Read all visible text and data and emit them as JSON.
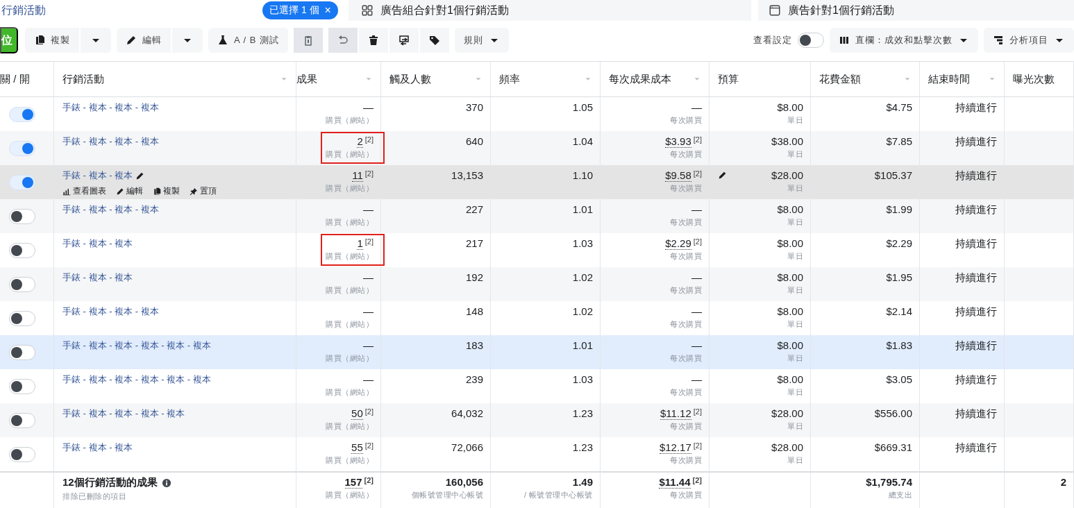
{
  "top_bar": {
    "breadcrumb": "行銷活動",
    "selection_chip": {
      "label": "已選擇 1 個",
      "close": "×"
    },
    "tabs": [
      {
        "kind": "ad_sets",
        "label": "廣告組合針對1個行銷活動"
      },
      {
        "kind": "ads",
        "label": "廣告針對1個行銷活動"
      }
    ]
  },
  "toolbar": {
    "create_button": "位",
    "items": [
      {
        "kind": "split",
        "label": "複製",
        "disabled": false
      },
      {
        "kind": "split",
        "label": "編輯",
        "disabled": false
      },
      {
        "kind": "button",
        "label": "A / B 測試",
        "disabled": false
      },
      {
        "kind": "icon",
        "disabled": true
      },
      {
        "kind": "icon",
        "disabled": true
      },
      {
        "kind": "icon",
        "disabled": false
      },
      {
        "kind": "icon",
        "disabled": false
      },
      {
        "kind": "icon",
        "disabled": false
      },
      {
        "kind": "dropdown",
        "label": "規則",
        "disabled": false
      }
    ],
    "view_settings": {
      "label": "查看設定",
      "on": false
    },
    "columns_button": "直欄：成效和點擊次數",
    "breakdown_button": "分析項目"
  },
  "table": {
    "columns": [
      {
        "label": "關 / 開",
        "sort_menu": false
      },
      {
        "label": "行銷活動",
        "sort_menu": true
      },
      {
        "label": "成果",
        "sort_menu": true
      },
      {
        "label": "觸及人數",
        "sort_menu": true
      },
      {
        "label": "頻率",
        "sort_menu": true
      },
      {
        "label": "每次成果成本",
        "sort_menu": true
      },
      {
        "label": "預算",
        "sort_menu": false
      },
      {
        "label": "花費金額",
        "sort_menu": true
      },
      {
        "label": "結束時間",
        "sort_menu": true
      },
      {
        "label": "曝光次數",
        "sort_menu": false
      }
    ],
    "rows": [
      {
        "on": true,
        "hovered": false,
        "highlighted": false,
        "annotated": false,
        "name": "手錶 - 複本 - 複本 - 複本",
        "result": "—",
        "result_note": "",
        "result_sub": "購買（網站）",
        "reach": "370",
        "frequency": "1.05",
        "cost": "—",
        "cost_note": "",
        "cost_sub": "每次購買",
        "budget": "$8.00",
        "budget_sub": "單日",
        "spent": "$4.75",
        "end": "持續進行"
      },
      {
        "on": true,
        "hovered": false,
        "highlighted": false,
        "annotated": true,
        "name": "手錶 - 複本 - 複本 - 複本",
        "result": "2",
        "result_note": "[2]",
        "result_sub": "購買（網站）",
        "reach": "640",
        "frequency": "1.04",
        "cost": "$3.93",
        "cost_note": "[2]",
        "cost_sub": "每次購買",
        "budget": "$38.00",
        "budget_sub": "單日",
        "spent": "$7.85",
        "end": "持續進行"
      },
      {
        "on": true,
        "hovered": true,
        "highlighted": false,
        "annotated": false,
        "name": "手錶 - 複本 - 複本",
        "result": "11",
        "result_note": "[2]",
        "result_sub": "購買（網站）",
        "reach": "13,153",
        "frequency": "1.10",
        "cost": "$9.58",
        "cost_note": "[2]",
        "cost_sub": "每次購買",
        "budget": "$28.00",
        "budget_sub": "單日",
        "spent": "$105.37",
        "end": "持續進行",
        "actions": [
          "查看圖表",
          "編輯",
          "複製",
          "置頂"
        ]
      },
      {
        "on": false,
        "hovered": false,
        "highlighted": false,
        "annotated": false,
        "name": "手錶 - 複本 - 複本 - 複本",
        "result": "—",
        "result_note": "",
        "result_sub": "購買（網站）",
        "reach": "227",
        "frequency": "1.01",
        "cost": "—",
        "cost_note": "",
        "cost_sub": "每次購買",
        "budget": "$8.00",
        "budget_sub": "單日",
        "spent": "$1.99",
        "end": "持續進行"
      },
      {
        "on": false,
        "hovered": false,
        "highlighted": false,
        "annotated": true,
        "name": "手錶 - 複本 - 複本",
        "result": "1",
        "result_note": "[2]",
        "result_sub": "購買（網站）",
        "reach": "217",
        "frequency": "1.03",
        "cost": "$2.29",
        "cost_note": "[2]",
        "cost_sub": "每次購買",
        "budget": "$8.00",
        "budget_sub": "單日",
        "spent": "$2.29",
        "end": "持續進行"
      },
      {
        "on": false,
        "hovered": false,
        "highlighted": false,
        "annotated": false,
        "name": "手錶 - 複本 - 複本",
        "result": "—",
        "result_note": "",
        "result_sub": "購買（網站）",
        "reach": "192",
        "frequency": "1.02",
        "cost": "—",
        "cost_note": "",
        "cost_sub": "每次購買",
        "budget": "$8.00",
        "budget_sub": "單日",
        "spent": "$1.95",
        "end": "持續進行"
      },
      {
        "on": false,
        "hovered": false,
        "highlighted": false,
        "annotated": false,
        "name": "手錶 - 複本 - 複本 - 複本",
        "result": "—",
        "result_note": "",
        "result_sub": "購買（網站）",
        "reach": "148",
        "frequency": "1.02",
        "cost": "—",
        "cost_note": "",
        "cost_sub": "每次購買",
        "budget": "$8.00",
        "budget_sub": "單日",
        "spent": "$2.14",
        "end": "持續進行"
      },
      {
        "on": false,
        "hovered": false,
        "highlighted": true,
        "annotated": false,
        "name": "手錶 - 複本 - 複本 - 複本 - 複本 - 複本",
        "result": "—",
        "result_note": "",
        "result_sub": "購買（網站）",
        "reach": "183",
        "frequency": "1.01",
        "cost": "—",
        "cost_note": "",
        "cost_sub": "每次購買",
        "budget": "$8.00",
        "budget_sub": "單日",
        "spent": "$1.83",
        "end": "持續進行"
      },
      {
        "on": false,
        "hovered": false,
        "highlighted": false,
        "annotated": false,
        "name": "手錶 - 複本 - 複本 - 複本 - 複本 - 複本",
        "result": "—",
        "result_note": "",
        "result_sub": "購買（網站）",
        "reach": "239",
        "frequency": "1.03",
        "cost": "—",
        "cost_note": "",
        "cost_sub": "每次購買",
        "budget": "$8.00",
        "budget_sub": "單日",
        "spent": "$3.05",
        "end": "持續進行"
      },
      {
        "on": false,
        "hovered": false,
        "highlighted": false,
        "annotated": false,
        "name": "手錶 - 複本 - 複本 - 複本 - 複本",
        "result": "50",
        "result_note": "[2]",
        "result_sub": "購買（網站）",
        "reach": "64,032",
        "frequency": "1.23",
        "cost": "$11.12",
        "cost_note": "[2]",
        "cost_sub": "每次購買",
        "budget": "$28.00",
        "budget_sub": "單日",
        "spent": "$556.00",
        "end": "持續進行"
      },
      {
        "on": false,
        "hovered": false,
        "highlighted": false,
        "annotated": false,
        "name": "手錶 - 複本 - 複本",
        "result": "55",
        "result_note": "[2]",
        "result_sub": "購買（網站）",
        "reach": "72,066",
        "frequency": "1.23",
        "cost": "$12.17",
        "cost_note": "[2]",
        "cost_sub": "每次購買",
        "budget": "$28.00",
        "budget_sub": "單日",
        "spent": "$669.31",
        "end": "持續進行"
      }
    ],
    "footer": {
      "title": "12個行銷活動的成果",
      "subtitle": "排除已刪除的項目",
      "result": "157",
      "result_note": "[2]",
      "result_sub": "購買（網站）",
      "reach": "160,056",
      "reach_sub": "個帳號管理中心帳號",
      "frequency": "1.49",
      "frequency_sub": "/ 帳號管理中心帳號",
      "cost": "$11.44",
      "cost_note": "[2]",
      "cost_sub": "每次購買",
      "spent": "$1,795.74",
      "spent_sub": "總支出",
      "impressions": "2"
    }
  }
}
